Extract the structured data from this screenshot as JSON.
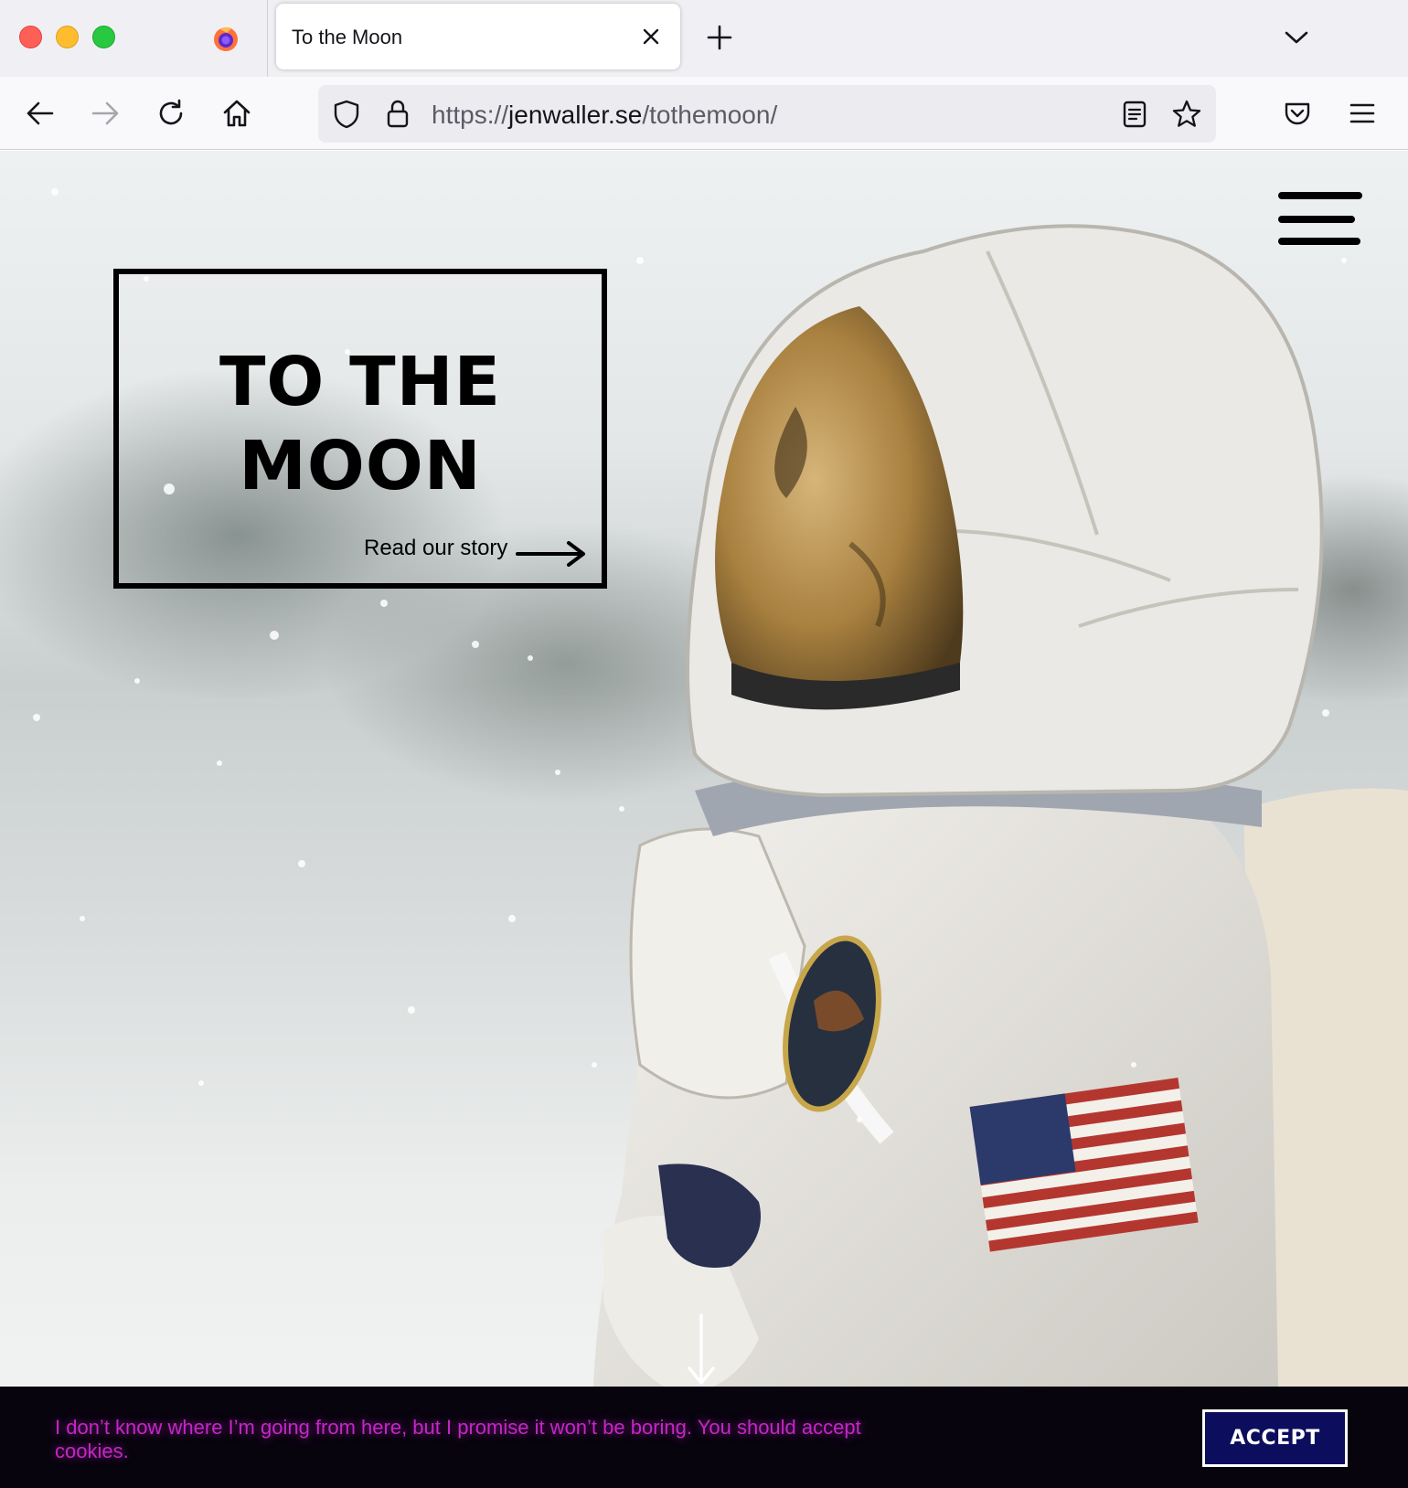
{
  "browser": {
    "tab_title": "To the Moon",
    "url_scheme": "https://",
    "url_host": "jenwaller.se",
    "url_path": "/tothemoon/"
  },
  "hero": {
    "title_line1": "TO THE",
    "title_line2": "MOON",
    "story_link": "Read our story"
  },
  "cookie": {
    "message": "I don’t know where I’m going from here, but I promise it won’t be boring. You should accept cookies.",
    "accept_label": "ACCEPT"
  },
  "colors": {
    "cookie_bg": "#07040d",
    "cookie_text": "#c327c6",
    "accept_bg": "#0d0d5e"
  }
}
